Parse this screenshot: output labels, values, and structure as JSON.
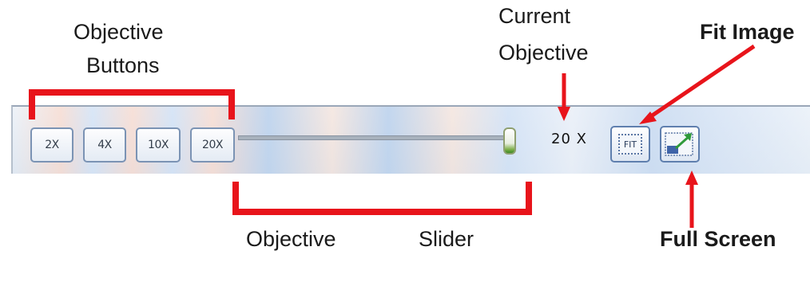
{
  "toolbar": {
    "objective_buttons": [
      {
        "label": "2X"
      },
      {
        "label": "4X"
      },
      {
        "label": "10X"
      },
      {
        "label": "20X"
      }
    ],
    "slider": {
      "value_fraction": 1.0
    },
    "current_objective": "20 X",
    "fit_image_icon_text": "FIT"
  },
  "annotations": {
    "objective_buttons_line1": "Objective",
    "objective_buttons_line2": "Buttons",
    "current_objective_line1": "Current",
    "current_objective_line2": "Objective",
    "fit_image": "Fit Image",
    "objective_slider_left": "Objective",
    "objective_slider_right": "Slider",
    "full_screen": "Full Screen"
  },
  "colors": {
    "annotation_red": "#e8141b",
    "button_border": "#7b93b4",
    "slider_thumb_green": "#3a8a24"
  },
  "icons": {
    "fit_image": "fit-image-icon",
    "full_screen": "full-screen-icon"
  }
}
